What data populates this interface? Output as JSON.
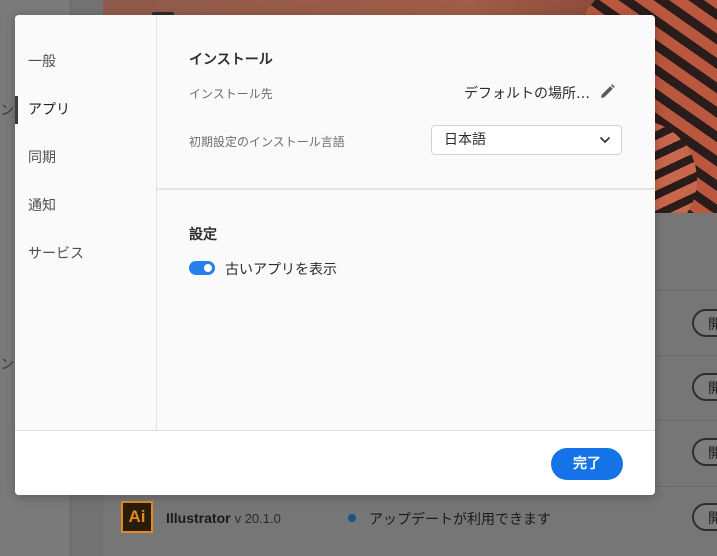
{
  "background": {
    "side_marks": [
      "ン",
      "ン"
    ],
    "open_button_label": "開",
    "app_row": {
      "icon_text": "Ai",
      "name": "Illustrator",
      "version": "v 20.1.0",
      "status": "アップデートが利用できます"
    }
  },
  "sidebar": {
    "items": [
      {
        "label": "一般",
        "active": false
      },
      {
        "label": "アプリ",
        "active": true
      },
      {
        "label": "同期",
        "active": false
      },
      {
        "label": "通知",
        "active": false
      },
      {
        "label": "サービス",
        "active": false
      }
    ]
  },
  "install": {
    "title": "インストール",
    "location_label": "インストール先",
    "location_value": "デフォルトの場所…",
    "language_label": "初期設定のインストール言語",
    "language_value": "日本語"
  },
  "settings": {
    "title": "設定",
    "toggle_label": "古いアプリを表示",
    "toggle_on": true
  },
  "footer": {
    "done_label": "完了"
  },
  "colors": {
    "accent": "#1473e6",
    "toggle": "#2680eb"
  }
}
